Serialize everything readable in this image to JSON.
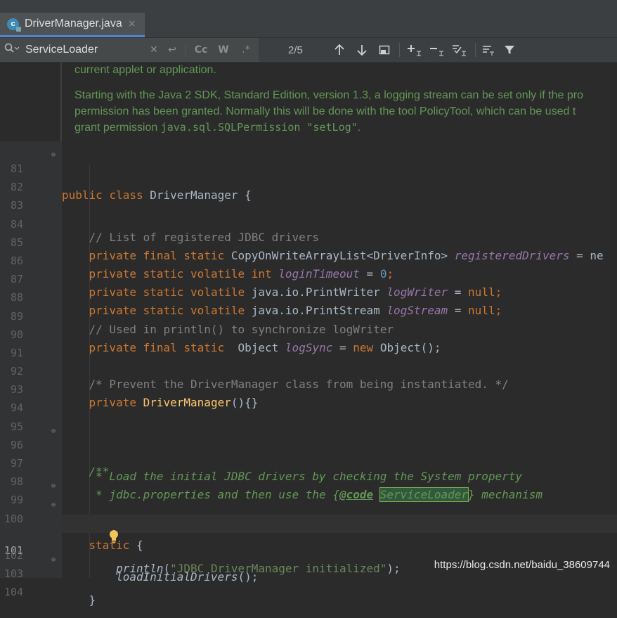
{
  "tab": {
    "icon_letter": "c",
    "title": "DriverManager.java",
    "close": "×"
  },
  "find": {
    "query": "ServiceLoader",
    "count": "2/5",
    "icons": [
      "search-icon",
      "clear-icon",
      "newline-icon",
      "match-case-icon",
      "words-icon",
      "regex-icon",
      "prev-occurrence-icon",
      "next-occurrence-icon",
      "open-in-window-icon",
      "add-selection-icon",
      "remove-selection-icon",
      "select-all-icon",
      "filter-icon",
      "funnel-icon"
    ],
    "match_case": "Cc",
    "words": "W",
    "regex": ".*"
  },
  "doc": {
    "line1": "current applet or application.",
    "line2": "Starting with the Java 2 SDK, Standard Edition, version 1.3, a logging stream can be set only if the pro",
    "line3": "permission has been granted. Normally this will be done with the tool PolicyTool, which can be used t",
    "line4_text": "grant permission ",
    "line4_code": "java.sql.SQLPermission \"setLog\"",
    "line4_end": "."
  },
  "code_lines": [
    {
      "n": "81"
    },
    {
      "n": "82"
    },
    {
      "n": "83"
    },
    {
      "n": "84"
    },
    {
      "n": "85"
    },
    {
      "n": "86"
    },
    {
      "n": "87"
    },
    {
      "n": "88"
    },
    {
      "n": "89"
    },
    {
      "n": "90"
    },
    {
      "n": "91"
    },
    {
      "n": "92"
    },
    {
      "n": "93"
    },
    {
      "n": "94"
    },
    {
      "n": "95"
    },
    {
      "n": "96"
    },
    {
      "n": "97"
    },
    {
      "n": "98"
    },
    {
      "n": "99"
    },
    {
      "n": "100"
    },
    {
      "n": "101"
    },
    {
      "n": "102"
    },
    {
      "n": "103"
    },
    {
      "n": "104"
    }
  ],
  "tokens": {
    "l81": [
      "public",
      "class",
      "DriverManager",
      "{"
    ],
    "l84": "// List of registered JDBC drivers",
    "l85": [
      "private",
      "final",
      "static",
      "CopyOnWriteArrayList<DriverInfo>",
      "registeredDrivers",
      "= ne"
    ],
    "l86": [
      "private",
      "static",
      "volatile",
      "int",
      "loginTimeout",
      "=",
      "0",
      ";"
    ],
    "l87": [
      "private",
      "static",
      "volatile",
      "java.io.PrintWriter",
      "logWriter",
      "=",
      "null",
      ";"
    ],
    "l88": [
      "private",
      "static",
      "volatile",
      "java.io.PrintStream",
      "logStream",
      "=",
      "null",
      ";"
    ],
    "l89": "// Used in println() to synchronize logWriter",
    "l90": [
      "private",
      "final",
      "static",
      "Object",
      "logSync",
      "=",
      "new",
      "Object();"
    ],
    "l92": "/* Prevent the DriverManager class from being instantiated. */",
    "l93": [
      "private",
      "DriverManager",
      "(){}"
    ],
    "l96": "/**",
    "l97": " * Load the initial JDBC drivers by checking the System property",
    "l98": [
      " * jdbc.properties and then use the {",
      "@code",
      "ServiceLoader",
      "} mechanism"
    ],
    "l99": " */",
    "l100": [
      "static",
      "{"
    ],
    "l101": [
      "loadInitialDrivers",
      "();"
    ],
    "l102": [
      "println",
      "(",
      "\"JDBC DriverManager initialized\"",
      ");"
    ],
    "l103": "}"
  },
  "watermark": "https://blog.csdn.net/baidu_38609744",
  "colors": {
    "background": "#2b2b2b",
    "keyword": "#cc7832",
    "comment": "#808080",
    "doc": "#629755",
    "field": "#9876aa",
    "number": "#6897bb",
    "method": "#ffc66d",
    "string": "#6a8759",
    "accent": "#4a88c7"
  }
}
